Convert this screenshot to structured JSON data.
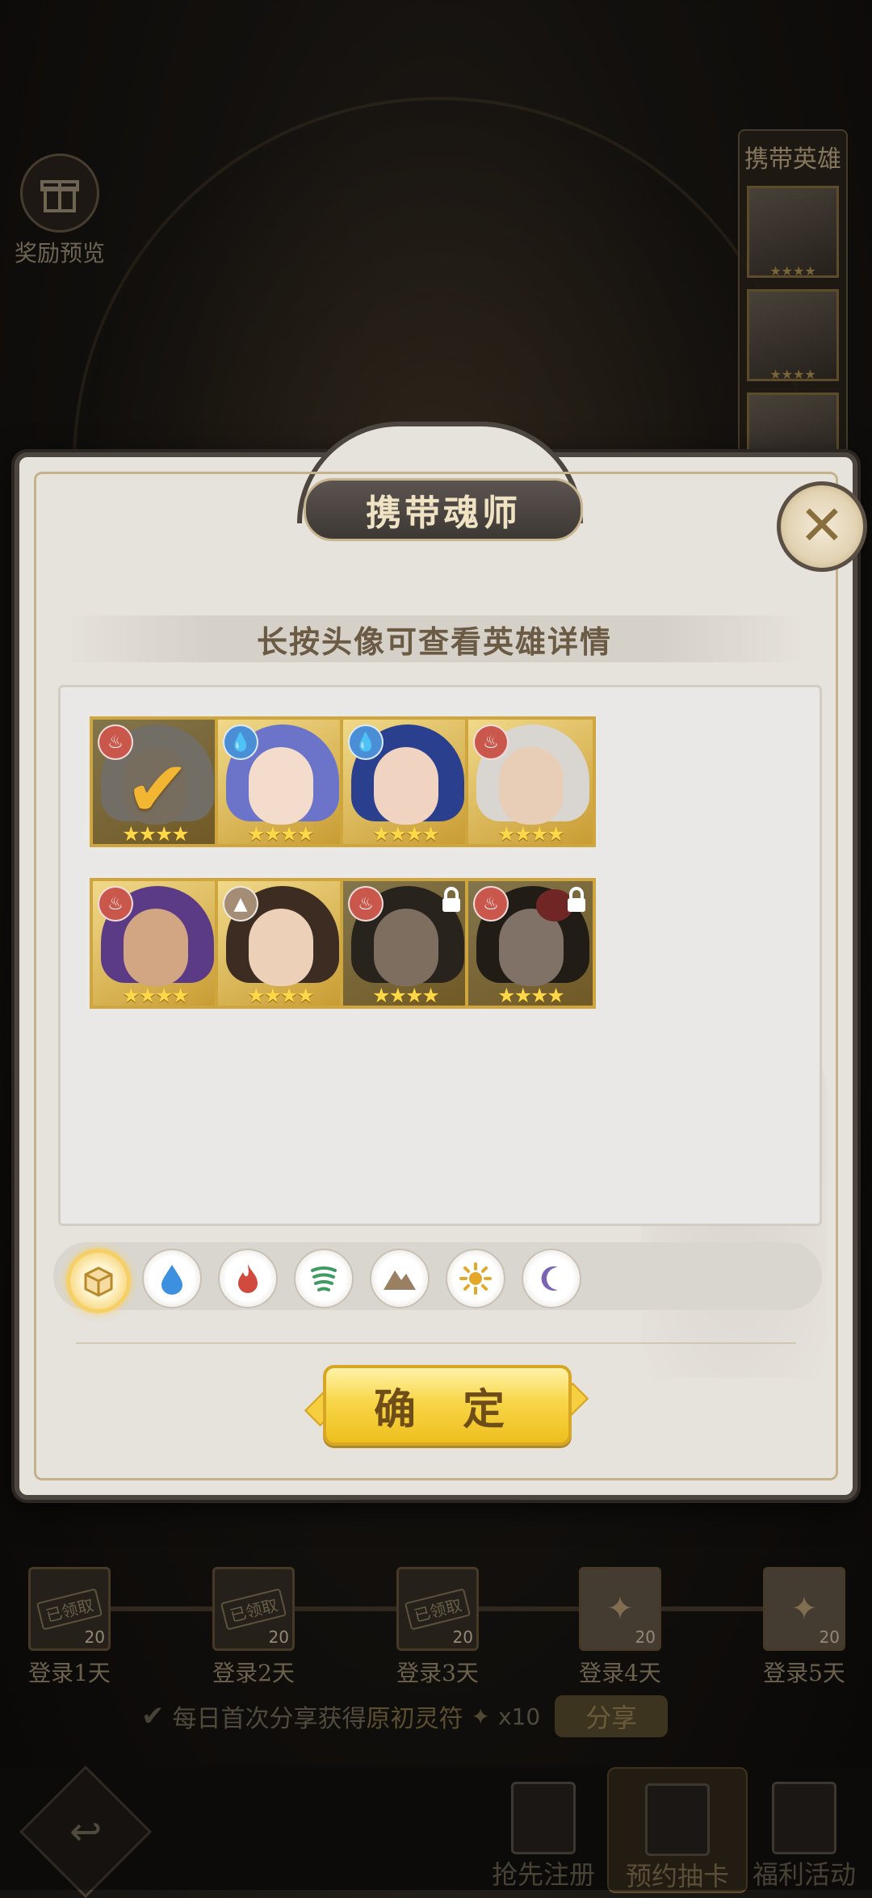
{
  "background": {
    "reward_preview_label": "奖励预览",
    "carry_panel_title": "携带英雄"
  },
  "modal": {
    "title": "携带魂师",
    "hint": "长按头像可查看英雄详情",
    "confirm_label": "确 定",
    "heroes": [
      {
        "element": "fire",
        "stars": "★★★★",
        "state": "selected"
      },
      {
        "element": "water",
        "stars": "★★★★",
        "state": "normal"
      },
      {
        "element": "water",
        "stars": "★★★★",
        "state": "normal"
      },
      {
        "element": "fire",
        "stars": "★★★★",
        "state": "normal"
      },
      {
        "element": "fire",
        "stars": "★★★★",
        "state": "normal"
      },
      {
        "element": "earth",
        "stars": "★★★★",
        "state": "normal"
      },
      {
        "element": "fire",
        "stars": "★★★★",
        "state": "locked"
      },
      {
        "element": "fire",
        "stars": "★★★★",
        "state": "locked"
      }
    ],
    "filters": [
      "all",
      "water",
      "fire",
      "wind",
      "earth",
      "light",
      "dark"
    ],
    "active_filter": "all"
  },
  "login": {
    "days": [
      {
        "label": "登录1天",
        "count": "20",
        "claimed": true,
        "stamp": "已领取"
      },
      {
        "label": "登录2天",
        "count": "20",
        "claimed": true,
        "stamp": "已领取"
      },
      {
        "label": "登录3天",
        "count": "20",
        "claimed": true,
        "stamp": "已领取"
      },
      {
        "label": "登录4天",
        "count": "20",
        "claimed": false,
        "stamp": ""
      },
      {
        "label": "登录5天",
        "count": "20",
        "claimed": false,
        "stamp": ""
      }
    ],
    "share_text_prefix": "每日首次分享获得",
    "share_text_item": "原初灵符",
    "share_multiplier": "x10",
    "share_button": "分享"
  },
  "nav": {
    "tabs": [
      {
        "label": "抢先注册",
        "active": false
      },
      {
        "label": "预约抽卡",
        "active": true
      },
      {
        "label": "福利活动",
        "active": false
      }
    ]
  },
  "colors": {
    "fire": "#c9574b",
    "water": "#4a8fd6",
    "earth": "#a58c74",
    "gold_border": "#cfa63d",
    "confirm": "#f8d648"
  }
}
